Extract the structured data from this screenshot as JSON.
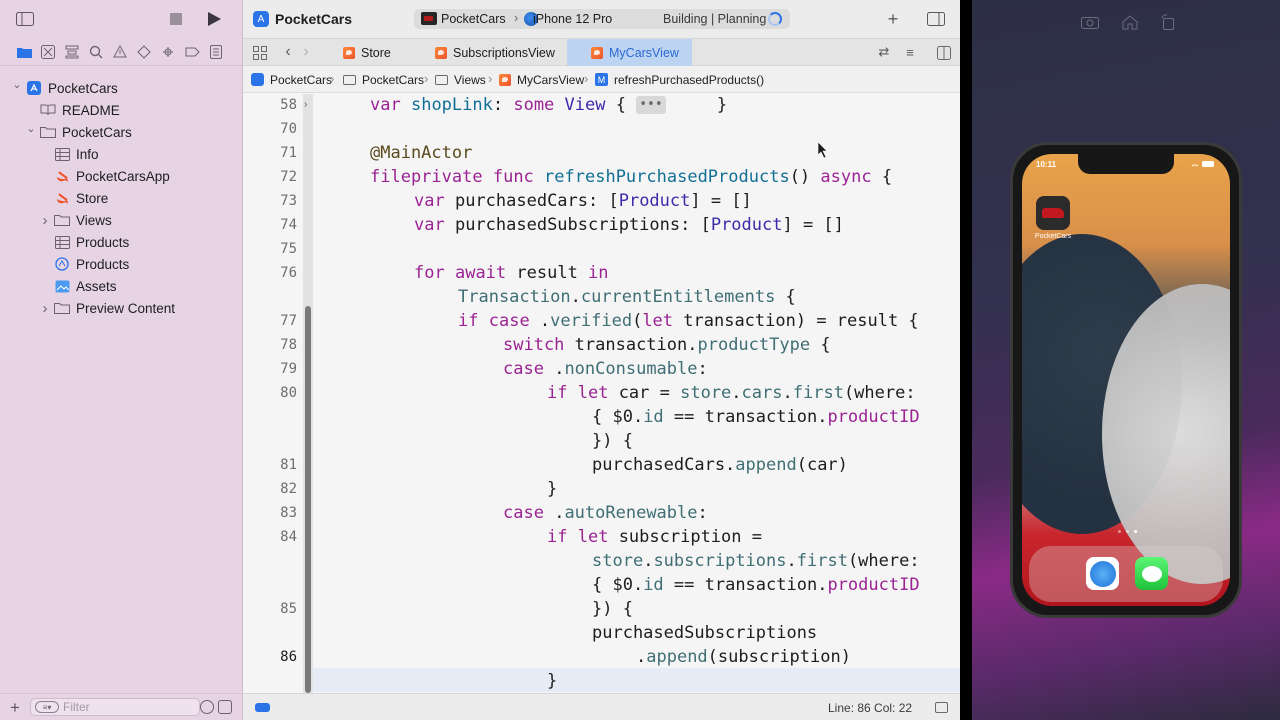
{
  "window": {
    "project_title": "PocketCars",
    "scheme": "PocketCars",
    "device": "iPhone 12 Pro",
    "status": "Building | Planning"
  },
  "sidebar": {
    "tree": [
      {
        "label": "PocketCars",
        "icon": "xcode-project-icon",
        "level": 0,
        "disclosure": "expanded"
      },
      {
        "label": "README",
        "icon": "book-icon",
        "level": 1,
        "disclosure": "none"
      },
      {
        "label": "PocketCars",
        "icon": "folder-icon",
        "level": 1,
        "disclosure": "expanded"
      },
      {
        "label": "Info",
        "icon": "table-icon",
        "level": 2,
        "disclosure": "none"
      },
      {
        "label": "PocketCarsApp",
        "icon": "swift-icon",
        "level": 2,
        "disclosure": "none"
      },
      {
        "label": "Store",
        "icon": "swift-icon",
        "level": 2,
        "disclosure": "none"
      },
      {
        "label": "Views",
        "icon": "folder-icon",
        "level": 2,
        "disclosure": "collapsed"
      },
      {
        "label": "Products",
        "icon": "table-icon",
        "level": 2,
        "disclosure": "none"
      },
      {
        "label": "Products",
        "icon": "storekit-icon",
        "level": 2,
        "disclosure": "none"
      },
      {
        "label": "Assets",
        "icon": "assets-icon",
        "level": 2,
        "disclosure": "none"
      },
      {
        "label": "Preview Content",
        "icon": "folder-icon",
        "level": 2,
        "disclosure": "collapsed"
      }
    ],
    "filter_placeholder": "Filter"
  },
  "tabs": [
    {
      "label": "Store",
      "active": false
    },
    {
      "label": "SubscriptionsView",
      "active": false
    },
    {
      "label": "MyCarsView",
      "active": true
    }
  ],
  "breadcrumb": [
    "PocketCars",
    "PocketCars",
    "Views",
    "MyCarsView",
    "refreshPurchasedProducts()"
  ],
  "code": {
    "line_numbers": [
      {
        "n": "58",
        "row": 0,
        "folded": true
      },
      {
        "n": "70",
        "row": 1
      },
      {
        "n": "71",
        "row": 2
      },
      {
        "n": "72",
        "row": 3
      },
      {
        "n": "73",
        "row": 4
      },
      {
        "n": "74",
        "row": 5
      },
      {
        "n": "75",
        "row": 6
      },
      {
        "n": "76",
        "row": 7
      },
      {
        "n": "77",
        "row": 9
      },
      {
        "n": "78",
        "row": 10
      },
      {
        "n": "79",
        "row": 11
      },
      {
        "n": "80",
        "row": 12
      },
      {
        "n": "81",
        "row": 15
      },
      {
        "n": "82",
        "row": 16
      },
      {
        "n": "83",
        "row": 17
      },
      {
        "n": "84",
        "row": 18
      },
      {
        "n": "85",
        "row": 21
      },
      {
        "n": "86",
        "row": 23,
        "current": true
      }
    ],
    "fold_placeholder": "•••",
    "current_line": 86
  },
  "status_bar": {
    "cursor_position": "Line: 86  Col: 22"
  },
  "simulator": {
    "clock": "10:11",
    "app_name": "PocketCars"
  },
  "colors": {
    "accent": "#2a74e8",
    "sidebar_bg": "#e6d4e4",
    "keyword": "#9b2393",
    "type": "#3b2bab"
  }
}
